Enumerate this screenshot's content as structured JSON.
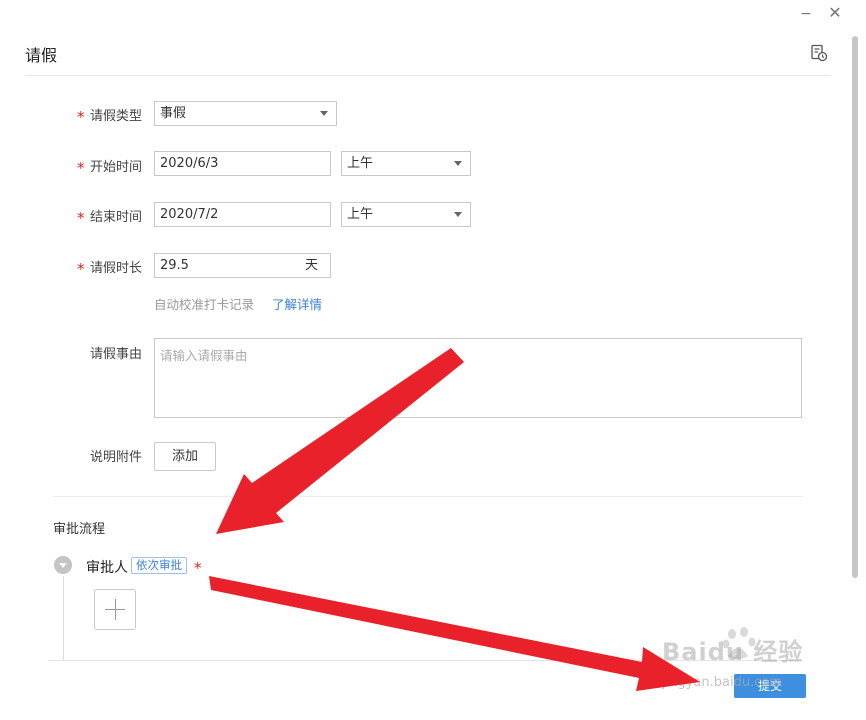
{
  "window": {
    "minimize_glyph": "−",
    "close_glyph": "✕"
  },
  "header": {
    "title": "请假",
    "history_icon": "history-doc-icon"
  },
  "form": {
    "required_mark": "*",
    "leave_type": {
      "label": "请假类型",
      "value": "事假"
    },
    "start_time": {
      "label": "开始时间",
      "date": "2020/6/3",
      "period": "上午"
    },
    "end_time": {
      "label": "结束时间",
      "date": "2020/7/2",
      "period": "上午"
    },
    "duration": {
      "label": "请假时长",
      "value": "29.5",
      "unit": "天"
    },
    "hint": {
      "text": "自动校准打卡记录",
      "link": "了解详情"
    },
    "reason": {
      "label": "请假事由",
      "placeholder": "请输入请假事由"
    },
    "attachment": {
      "label": "说明附件",
      "button": "添加"
    }
  },
  "approval": {
    "section_title": "审批流程",
    "approver_label": "审批人",
    "mode_tag": "依次审批",
    "required_mark": "*"
  },
  "footer": {
    "submit": "提交"
  },
  "watermark": {
    "logo": "Baidu 经验",
    "url": "jingyan.baidu.com"
  },
  "colors": {
    "accent": "#3e8fe0",
    "required": "#e2231a",
    "annotation_arrow": "#e8212a"
  }
}
